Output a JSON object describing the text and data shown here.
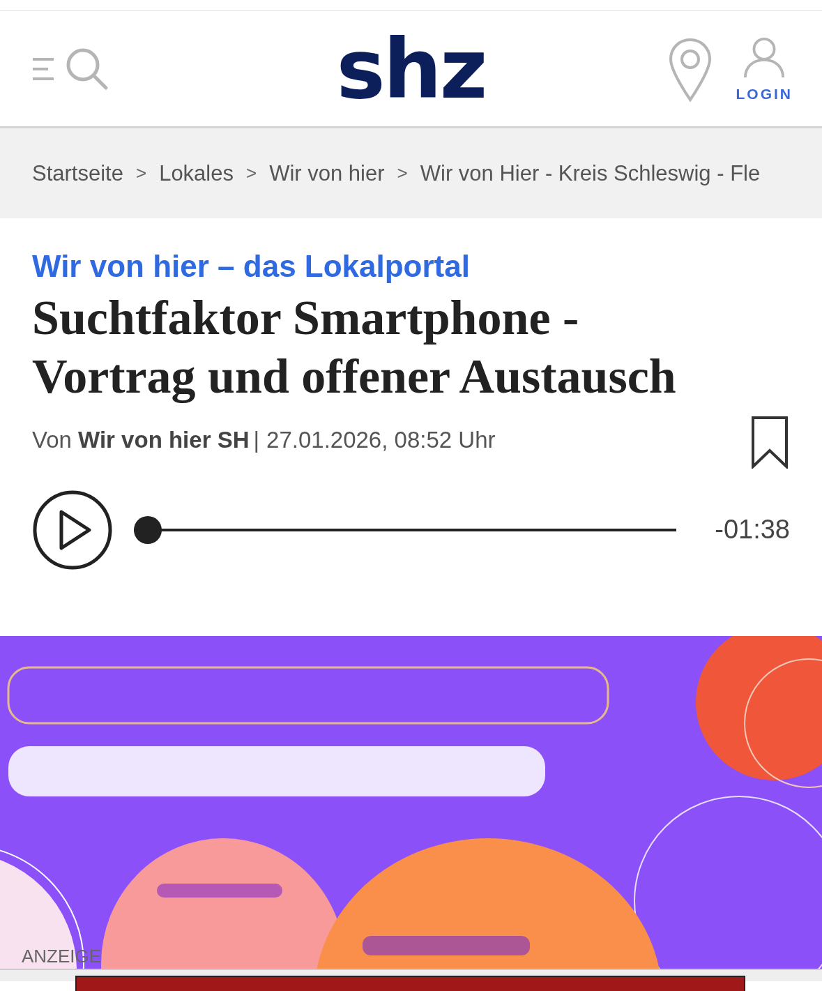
{
  "header": {
    "logo": "shz",
    "login_label": "LOGIN"
  },
  "breadcrumb": [
    "Startseite",
    "Lokales",
    "Wir von hier",
    "Wir von Hier - Kreis Schleswig - Fle"
  ],
  "breadcrumb_separator": ">",
  "article": {
    "kicker": "Wir von hier – das Lokalportal",
    "headline": "Suchtfaktor Smartphone - Vortrag und offener Austausch",
    "byline": "Von **Wir von hier SH**",
    "byline_separator": "|",
    "date": "27.01.2026, 08:52 Uhr",
    "bookmarked": false
  },
  "audio_player": {
    "playing": false,
    "level": 0,
    "time": "-01:38"
  },
  "image": {
    "kind": "picture",
    "label": "ANZEIGE"
  }
}
